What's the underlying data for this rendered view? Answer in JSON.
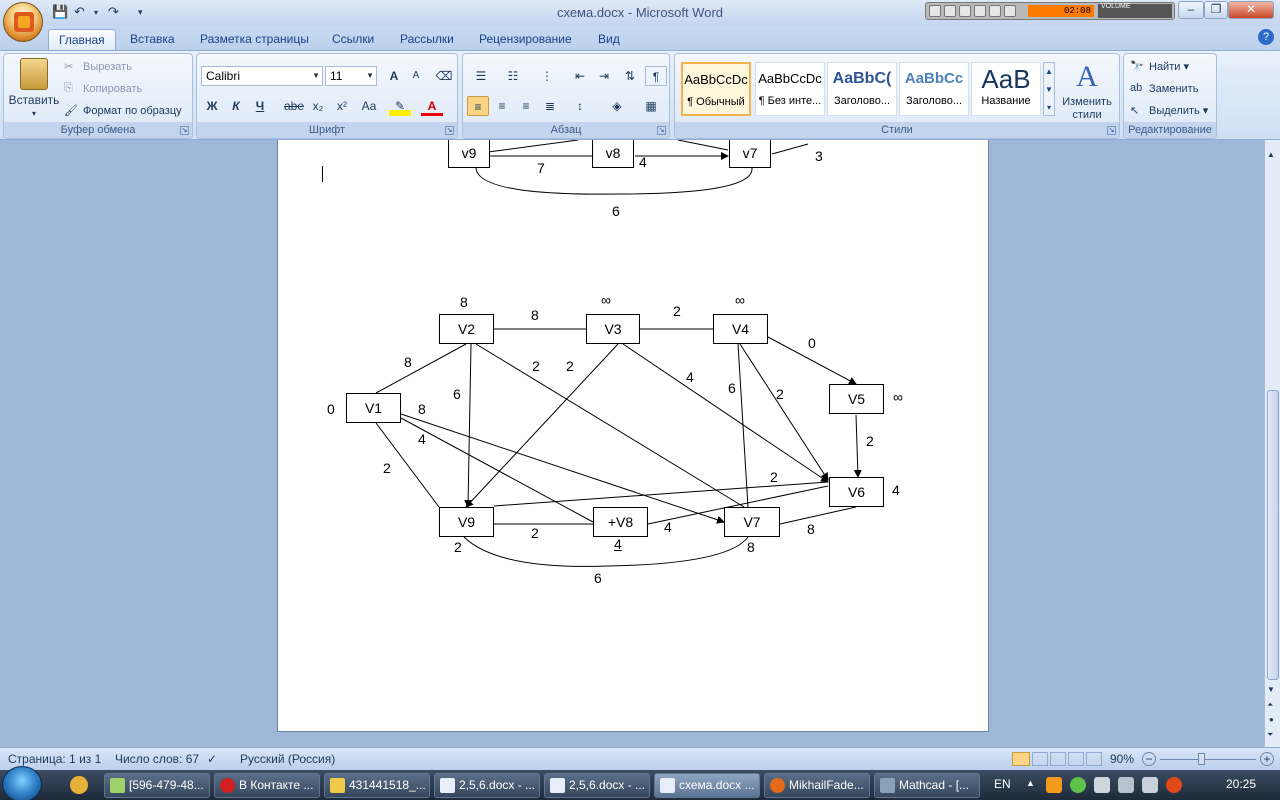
{
  "window": {
    "title": "схема.docx - Microsoft Word",
    "media_display": "02:08",
    "volume_label": "VOLUME"
  },
  "tabs": [
    "Главная",
    "Вставка",
    "Разметка страницы",
    "Ссылки",
    "Рассылки",
    "Рецензирование",
    "Вид"
  ],
  "clipboard": {
    "paste": "Вставить",
    "cut": "Вырезать",
    "copy": "Копировать",
    "format_painter": "Формат по образцу",
    "label": "Буфер обмена"
  },
  "font": {
    "name": "Calibri",
    "size": "11",
    "label": "Шрифт",
    "bold": "Ж",
    "italic": "К",
    "underline": "Ч",
    "strike": "abe",
    "subscript": "x₂",
    "superscript": "x²",
    "change_case": "Aa",
    "grow": "A",
    "shrink": "A"
  },
  "paragraph": {
    "label": "Абзац",
    "pilcrow": "¶"
  },
  "styles": {
    "label": "Стили",
    "items": [
      {
        "sample": "AaBbCcDc",
        "name": "¶ Обычный"
      },
      {
        "sample": "AaBbCcDc",
        "name": "¶ Без инте..."
      },
      {
        "sample": "AaBbC(",
        "name": "Заголово..."
      },
      {
        "sample": "AaBbCc",
        "name": "Заголово..."
      },
      {
        "sample": "AaB",
        "name": "Название"
      }
    ],
    "change_styles": "Изменить стили"
  },
  "editing": {
    "find": "Найти",
    "replace": "Заменить",
    "select": "Выделить",
    "label": "Редактирование"
  },
  "graph_top": {
    "nodes": [
      {
        "label": "v9"
      },
      {
        "label": "v8"
      },
      {
        "label": "v7"
      }
    ],
    "weights": [
      "7",
      "4",
      "3",
      "6"
    ]
  },
  "graph_main": {
    "nodes": [
      {
        "id": "V2",
        "label": "V2"
      },
      {
        "id": "V3",
        "label": "V3"
      },
      {
        "id": "V4",
        "label": "V4"
      },
      {
        "id": "V1",
        "label": "V1"
      },
      {
        "id": "V5",
        "label": "V5"
      },
      {
        "id": "V6",
        "label": "V6"
      },
      {
        "id": "V9",
        "label": "V9"
      },
      {
        "id": "V8",
        "label": "+V8"
      },
      {
        "id": "V7",
        "label": "V7"
      }
    ],
    "node_marks": [
      "8",
      "∞",
      "∞",
      "0",
      "∞",
      "4",
      "2",
      "4",
      "8"
    ],
    "edge_weights": [
      "8",
      "2",
      "0",
      "8",
      "2",
      "2",
      "4",
      "6",
      "2",
      "8",
      "6",
      "2",
      "4",
      "2",
      "2",
      "2",
      "4",
      "8",
      "6"
    ]
  },
  "status": {
    "page": "Страница: 1 из 1",
    "words": "Число слов: 67",
    "language": "Русский (Россия)",
    "zoom": "90%"
  },
  "taskbar": {
    "tasks": [
      "[596-479-48...",
      "В Контакте ...",
      "431441518_...",
      "2,5,6.docx - ...",
      "2,5,6.docx - ...",
      "схема.docx ...",
      "MikhailFade...",
      "Mathcad - [..."
    ],
    "lang": "EN",
    "clock": "20:25"
  }
}
